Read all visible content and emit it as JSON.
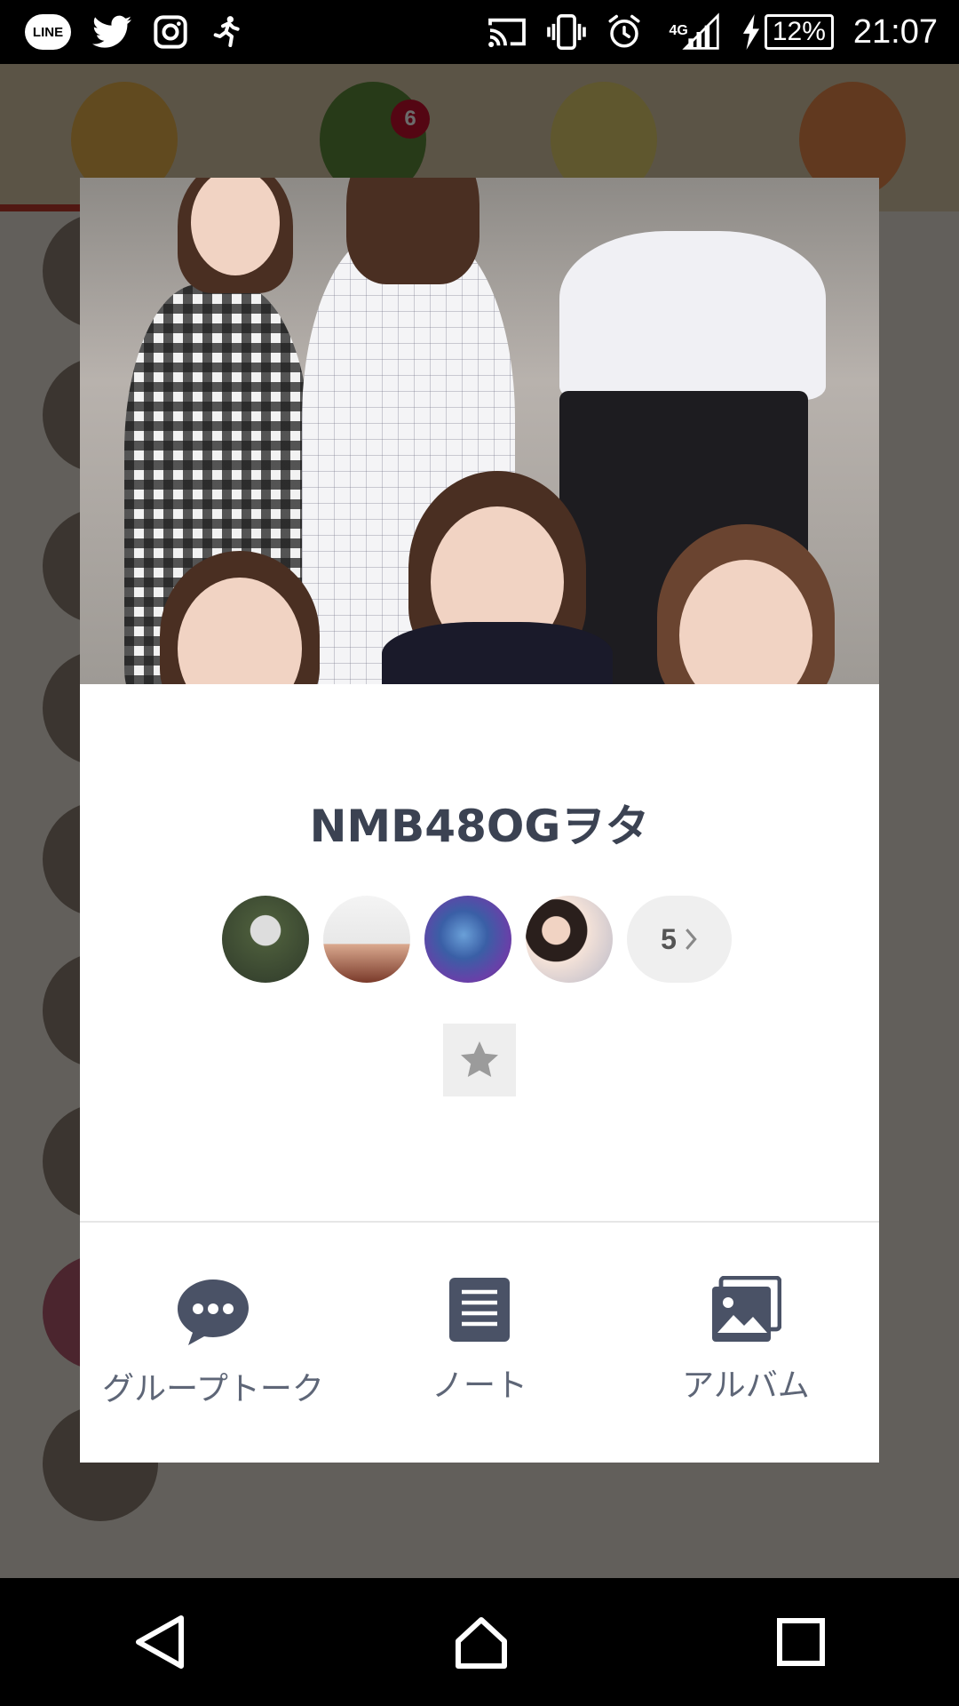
{
  "status_bar": {
    "time": "21:07",
    "battery": "12%",
    "network": "4G",
    "notification_icons": [
      "line-icon",
      "twitter-icon",
      "instagram-icon",
      "runner-icon"
    ],
    "system_icons": [
      "cast-icon",
      "vibrate-icon",
      "alarm-icon",
      "signal-icon",
      "charging-icon",
      "battery-icon"
    ]
  },
  "background": {
    "tab_badge": "6"
  },
  "dialog": {
    "group_name": "NMB48OGヲタ",
    "member_more_count": "5",
    "actions": [
      {
        "label": "グループトーク",
        "icon": "chat-bubble-icon"
      },
      {
        "label": "ノート",
        "icon": "note-icon"
      },
      {
        "label": "アルバム",
        "icon": "album-icon"
      }
    ]
  },
  "nav_bar": {
    "buttons": [
      "back-icon",
      "home-icon",
      "recents-icon"
    ]
  },
  "colors": {
    "accent": "#3b4252",
    "icon": "#4a5266",
    "badge": "#c8102e"
  }
}
